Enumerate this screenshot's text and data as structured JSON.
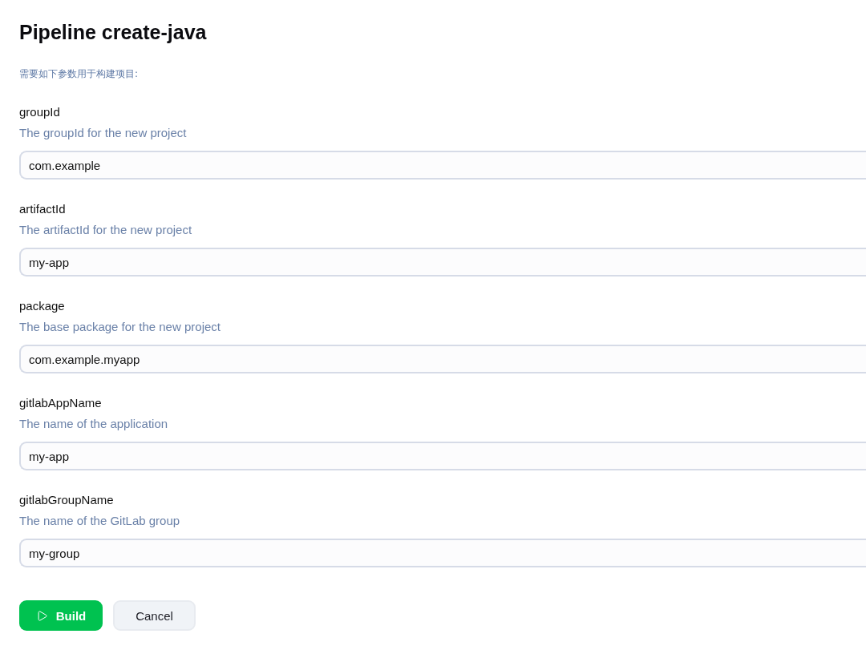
{
  "page": {
    "title": "Pipeline create-java",
    "intro": "需要如下参数用于构建项目:"
  },
  "parameters": [
    {
      "name": "groupId",
      "description": "The groupId for the new project",
      "value": "com.example"
    },
    {
      "name": "artifactId",
      "description": "The artifactId for the new project",
      "value": "my-app"
    },
    {
      "name": "package",
      "description": "The base package for the new project",
      "value": "com.example.myapp"
    },
    {
      "name": "gitlabAppName",
      "description": "The name of the application",
      "value": "my-app"
    },
    {
      "name": "gitlabGroupName",
      "description": "The name of the GitLab group",
      "value": "my-group"
    }
  ],
  "buttons": [
    {
      "kind": "primary",
      "label": "Build"
    },
    {
      "kind": "secondary",
      "label": "Cancel"
    }
  ]
}
